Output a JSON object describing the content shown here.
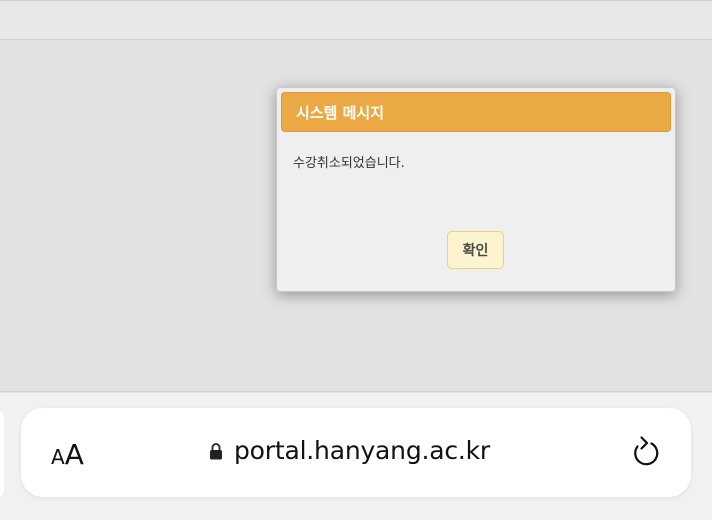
{
  "dialog": {
    "title": "시스템 메시지",
    "message": "수강취소되었습니다.",
    "confirm_label": "확인",
    "header_color": "#eba945",
    "button_color": "#fdf3cf"
  },
  "browser": {
    "text_size_small": "A",
    "text_size_large": "A",
    "url": "portal.hanyang.ac.kr",
    "icons": {
      "lock": "lock-icon",
      "reload": "reload-icon"
    }
  }
}
